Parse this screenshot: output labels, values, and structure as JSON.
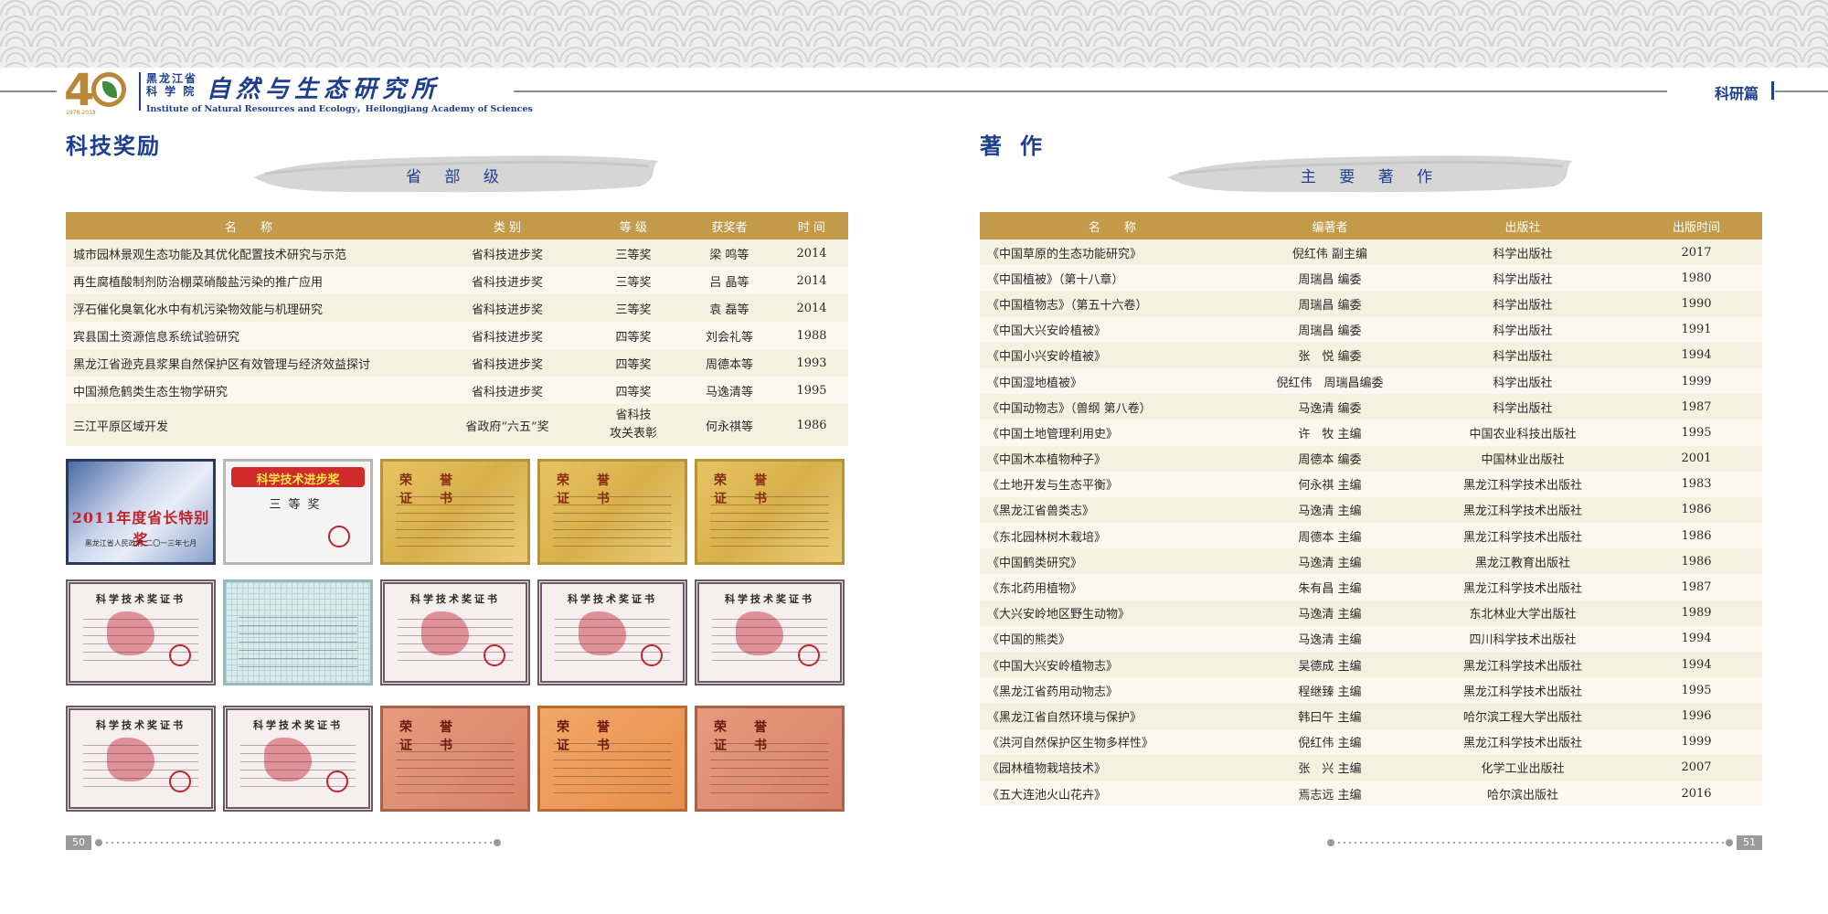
{
  "header": {
    "logo_years": "1978-2018",
    "org_line1": "黑龙江省",
    "org_line2": "科 学 院",
    "institute_calligraphy": "自然与生态研究所",
    "institute_en": "Institute of Natural Resources and Ecology，Heilongjiang Academy of Sciences",
    "section_tag": "科研篇"
  },
  "left_page": {
    "title": "科技奖励",
    "banner": "省 部 级",
    "awards_table": {
      "headers": [
        "名　　称",
        "类 别",
        "等 级",
        "获奖者",
        "时 间"
      ],
      "rows": [
        [
          "城市园林景观生态功能及其优化配置技术研究与示范",
          "省科技进步奖",
          "三等奖",
          "梁 鸣等",
          "2014"
        ],
        [
          "再生腐植酸制剂防治棚菜硝酸盐污染的推广应用",
          "省科技进步奖",
          "三等奖",
          "吕 晶等",
          "2014"
        ],
        [
          "浮石催化臭氧化水中有机污染物效能与机理研究",
          "省科技进步奖",
          "三等奖",
          "袁 磊等",
          "2014"
        ],
        [
          "宾县国土资源信息系统试验研究",
          "省科技进步奖",
          "四等奖",
          "刘会礼等",
          "1988"
        ],
        [
          "黑龙江省逊克县浆果自然保护区有效管理与经济效益探讨",
          "省科技进步奖",
          "四等奖",
          "周德本等",
          "1993"
        ],
        [
          "中国濒危鹤类生态生物学研究",
          "省科技进步奖",
          "四等奖",
          "马逸清等",
          "1995"
        ],
        [
          "三江平原区域开发",
          "省政府“六五”奖",
          "省科技\n攻关表彰",
          "何永祺等",
          "1986"
        ]
      ]
    },
    "certificates": {
      "plaque_title": "2011年度省长特别奖",
      "plaque_sub": "黑龙江省人民政府 二〇一三年七月",
      "banner_award": "科学技术进步奖",
      "third_prize": "三等奖",
      "honor_title": "荣誉　证书",
      "cert_title": "科学技术奖证书"
    },
    "page_number": "50"
  },
  "right_page": {
    "title": "著作",
    "banner": "主 要 著 作",
    "books_table": {
      "headers": [
        "名　　称",
        "编著者",
        "出版社",
        "出版时间"
      ],
      "rows": [
        [
          "《中国草原的生态功能研究》",
          "倪红伟 副主编",
          "科学出版社",
          "2017"
        ],
        [
          "《中国植被》（第十八章）",
          "周瑞昌 编委",
          "科学出版社",
          "1980"
        ],
        [
          "《中国植物志》（第五十六卷）",
          "周瑞昌 编委",
          "科学出版社",
          "1990"
        ],
        [
          "《中国大兴安岭植被》",
          "周瑞昌 编委",
          "科学出版社",
          "1991"
        ],
        [
          "《中国小兴安岭植被》",
          "张　悦 编委",
          "科学出版社",
          "1994"
        ],
        [
          "《中国湿地植被》",
          "倪红伟　周瑞昌编委",
          "科学出版社",
          "1999"
        ],
        [
          "《中国动物志》（兽纲 第八卷）",
          "马逸清 编委",
          "科学出版社",
          "1987"
        ],
        [
          "《中国土地管理利用史》",
          "许　牧 主编",
          "中国农业科技出版社",
          "1995"
        ],
        [
          "《中国木本植物种子》",
          "周德本 编委",
          "中国林业出版社",
          "2001"
        ],
        [
          "《土地开发与生态平衡》",
          "何永祺 主编",
          "黑龙江科学技术出版社",
          "1983"
        ],
        [
          "《黑龙江省兽类志》",
          "马逸清 主编",
          "黑龙江科学技术出版社",
          "1986"
        ],
        [
          "《东北园林树木栽培》",
          "周德本 主编",
          "黑龙江科学技术出版社",
          "1986"
        ],
        [
          "《中国鹤类研究》",
          "马逸清 主编",
          "黑龙江教育出版社",
          "1986"
        ],
        [
          "《东北药用植物》",
          "朱有昌 主编",
          "黑龙江科学技术出版社",
          "1987"
        ],
        [
          "《大兴安岭地区野生动物》",
          "马逸清 主编",
          "东北林业大学出版社",
          "1989"
        ],
        [
          "《中国的熊类》",
          "马逸清 主编",
          "四川科学技术出版社",
          "1994"
        ],
        [
          "《中国大兴安岭植物志》",
          "吴德成 主编",
          "黑龙江科学技术出版社",
          "1994"
        ],
        [
          "《黑龙江省药用动物志》",
          "程继臻 主编",
          "黑龙江科学技术出版社",
          "1995"
        ],
        [
          "《黑龙江省自然环境与保护》",
          "韩曰午 主编",
          "哈尔滨工程大学出版社",
          "1996"
        ],
        [
          "《洪河自然保护区生物多样性》",
          "倪红伟 主编",
          "黑龙江科学技术出版社",
          "1999"
        ],
        [
          "《园林植物栽培技术》",
          "张　兴 主编",
          "化学工业出版社",
          "2007"
        ],
        [
          "《五大连池火山花卉》",
          "焉志远 主编",
          "哈尔滨出版社",
          "2016"
        ]
      ]
    },
    "page_number": "51"
  },
  "colors": {
    "brand_blue": "#1d3f8f",
    "table_header_gold": "#c29a4a",
    "logo_gold": "#b8873a"
  }
}
